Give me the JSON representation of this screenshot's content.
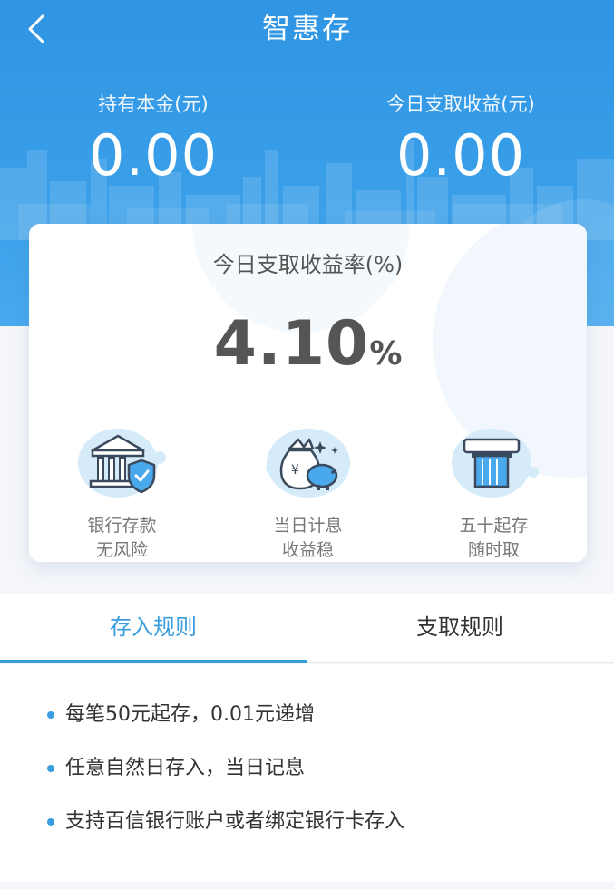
{
  "header": {
    "title": "智惠存",
    "back_icon": "chevron-left-icon",
    "stats": [
      {
        "label": "持有本金(元)",
        "value": "0.00"
      },
      {
        "label": "今日支取收益(元)",
        "value": "0.00"
      }
    ]
  },
  "rate_card": {
    "label": "今日支取收益率(%)",
    "value": "4.10",
    "unit": "%",
    "features": [
      {
        "icon": "bank-shield-icon",
        "line1": "银行存款",
        "line2": "无风险"
      },
      {
        "icon": "money-bag-piggy-icon",
        "line1": "当日计息",
        "line2": "收益稳"
      },
      {
        "icon": "atm-card-icon",
        "line1": "五十起存",
        "line2": "随时取"
      }
    ]
  },
  "tabs": [
    {
      "label": "存入规则",
      "active": true
    },
    {
      "label": "支取规则",
      "active": false
    }
  ],
  "rules": [
    "每笔50元起存，0.01元递增",
    "任意自然日存入，当日记息",
    "支持百信银行账户或者绑定银行卡存入"
  ],
  "colors": {
    "accent": "#3a9de0",
    "header_blue": "#2f95e4",
    "text_dark": "#333333",
    "text_gray": "#777777"
  }
}
